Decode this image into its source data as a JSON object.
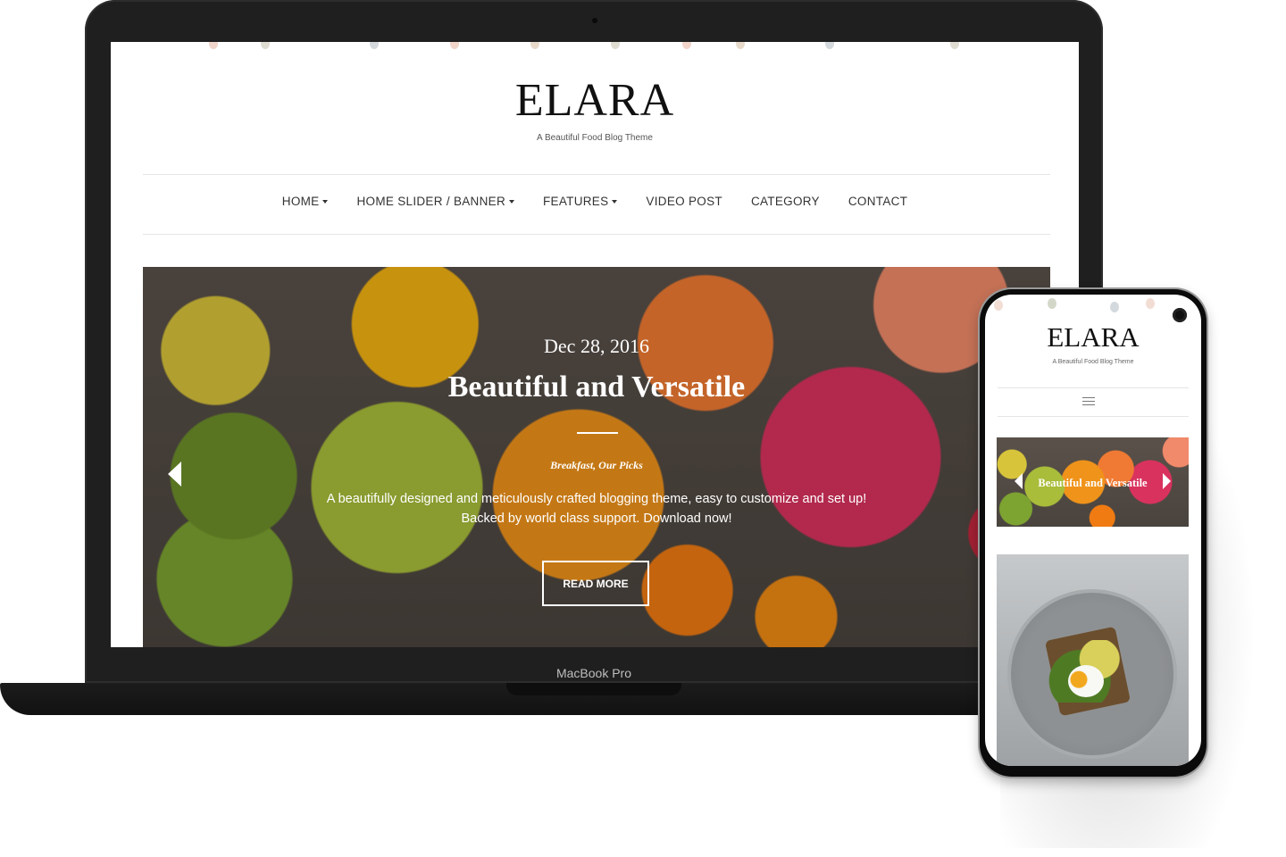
{
  "laptop": {
    "device_label": "MacBook Pro",
    "site": {
      "logo": "ELARA",
      "tagline": "A Beautiful Food Blog Theme",
      "nav": [
        {
          "label": "HOME",
          "has_dropdown": true
        },
        {
          "label": "HOME SLIDER / BANNER",
          "has_dropdown": true
        },
        {
          "label": "FEATURES",
          "has_dropdown": true
        },
        {
          "label": "VIDEO POST",
          "has_dropdown": false
        },
        {
          "label": "CATEGORY",
          "has_dropdown": false
        },
        {
          "label": "CONTACT",
          "has_dropdown": false
        }
      ],
      "slider": {
        "date": "Dec 28, 2016",
        "title": "Beautiful and Versatile",
        "categories": "Breakfast, Our Picks",
        "excerpt": "A beautifully designed and meticulously crafted blogging theme, easy to customize and set up! Backed by world class support. Download now!",
        "button_label": "READ MORE",
        "prev_icon": "arrow-left-icon"
      }
    }
  },
  "phone": {
    "site": {
      "logo": "ELARA",
      "tagline": "A Beautiful Food Blog Theme",
      "menu_icon": "hamburger-menu-icon",
      "slider": {
        "title": "Beautiful and Versatile",
        "prev_icon": "arrow-left-icon",
        "next_icon": "arrow-right-icon"
      },
      "post_image": "avocado-toast-with-poached-egg"
    }
  },
  "colors": {
    "device_body": "#1f1f1f",
    "text_dark": "#111111",
    "nav_text": "#333333",
    "divider": "#e5e5e5",
    "overlay_text": "#ffffff"
  }
}
